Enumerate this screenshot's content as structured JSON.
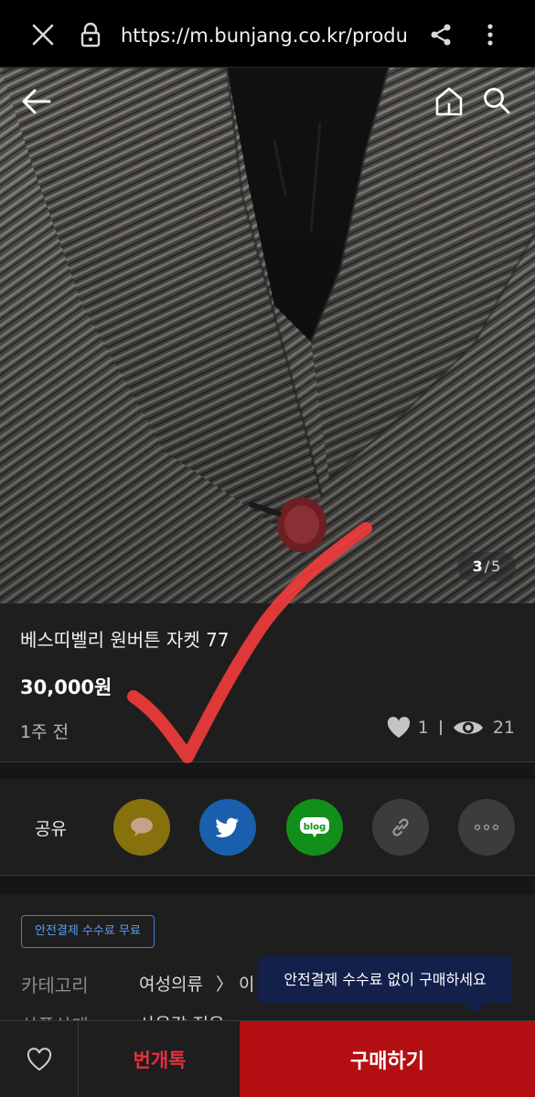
{
  "browser": {
    "url": "https://m.bunjang.co.kr/produ",
    "icons": [
      "close-icon",
      "lock-icon",
      "share-icon",
      "more-vertical-icon"
    ]
  },
  "gallery": {
    "current": "3",
    "total": "5",
    "icons": [
      "back-arrow-icon",
      "home-icon",
      "search-icon"
    ]
  },
  "product": {
    "title": "베스띠벨리 원버튼 자켓 77",
    "price": "30,000원",
    "posted": "1주 전",
    "likes": "1",
    "views": "21"
  },
  "share": {
    "label": "공유",
    "targets": [
      {
        "name": "kakaotalk",
        "color": "#86710d"
      },
      {
        "name": "twitter",
        "color": "#1a5fae"
      },
      {
        "name": "blog",
        "color": "#128f1b",
        "text": "blog"
      },
      {
        "name": "copy-link",
        "color": "#3c3c3c"
      },
      {
        "name": "more",
        "color": "#3c3c3c"
      }
    ]
  },
  "details": {
    "badge": "안전결제 수수료 무료",
    "category_label": "카테고리",
    "category_value": "여성의류",
    "category_next": "〉 이",
    "condition_label": "상품상태",
    "condition_value": "사용감 적음"
  },
  "tooltip": "안전결제 수수료 없이 구매하세요",
  "actions": {
    "chat": "번개톡",
    "buy": "구매하기"
  },
  "colors": {
    "accent_red": "#b30f12",
    "chat_red": "#e5303d",
    "badge_blue": "#3b7fd6",
    "tooltip_navy": "#12204a"
  }
}
